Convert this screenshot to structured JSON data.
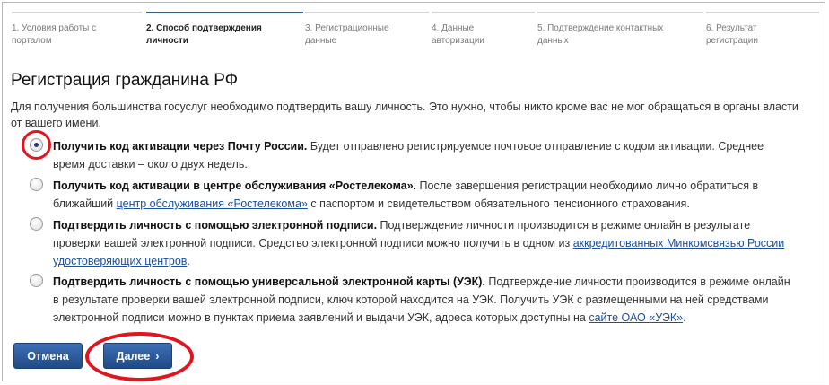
{
  "steps": [
    {
      "line1": "1. Условия работы с",
      "line2": "порталом",
      "active": false
    },
    {
      "line1": "2. Способ подтверждения",
      "line2": "личности",
      "active": true
    },
    {
      "line1": "3. Регистрационные",
      "line2": "данные",
      "active": false
    },
    {
      "line1": "4. Данные",
      "line2": "авторизации",
      "active": false
    },
    {
      "line1": "5. Подтверждение контактных",
      "line2": "данных",
      "active": false
    },
    {
      "line1": "6. Результат",
      "line2": "регистрации",
      "active": false
    }
  ],
  "page": {
    "title": "Регистрация гражданина РФ",
    "intro": "Для получения большинства госуслуг необходимо подтвердить вашу личность. Это нужно, чтобы никто кроме вас не мог обращаться в органы власти от вашего имени."
  },
  "options": [
    {
      "bold": "Получить код активации через Почту России.",
      "text": " Будет отправлено регистрируемое почтовое отправление с кодом активации. Среднее время доставки – около двух недель.",
      "checked": true
    },
    {
      "bold": "Получить код активации в центре обслуживания «Ростелекома».",
      "text": " После завершения регистрации необходимо лично обратиться в ближайший ",
      "link": "центр обслуживания «Ростелекома»",
      "after": " с паспортом и свидетельством обязательного пенсионного страхования.",
      "checked": false
    },
    {
      "bold": "Подтвердить личность с помощью электронной подписи.",
      "text": " Подтверждение личности производится в режиме онлайн в результате проверки вашей электронной подписи. Средство электронной подписи можно получить в одном из ",
      "link": "аккредитованных Минкомсвязью России удостоверяющих центров",
      "after": ".",
      "checked": false
    },
    {
      "bold": "Подтвердить личность с помощью универсальной электронной карты (УЭК).",
      "text": " Подтверждение личности производится в режиме онлайн в результате проверки вашей электронной подписи, ключ которой находится на УЭК. Получить УЭК с размещенными на ней средствами электронной подписи можно в пунктах приема заявлений и выдачи УЭК, адреса которых доступны на ",
      "link": "сайте ОАО «УЭК»",
      "after": ".",
      "checked": false
    }
  ],
  "buttons": {
    "cancel": "Отмена",
    "next": "Далее"
  },
  "colors": {
    "accent": "#2a5f9e",
    "highlight": "#e0151d",
    "link": "#1a4f99"
  }
}
